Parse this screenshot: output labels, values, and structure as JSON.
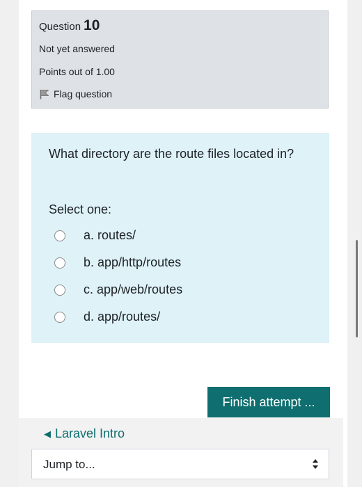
{
  "question": {
    "label": "Question",
    "number": "10",
    "state": "Not yet answered",
    "grade": "Points out of 1.00",
    "flag_label": "Flag question"
  },
  "formulation": {
    "text": "What directory are the route files located in?",
    "prompt": "Select one:",
    "options": [
      {
        "label": "a. routes/"
      },
      {
        "label": "b. app/http/routes"
      },
      {
        "label": "c. app/web/routes"
      },
      {
        "label": "d. app/routes/"
      }
    ]
  },
  "finish_button": {
    "label": "Finish attempt ..."
  },
  "nav": {
    "prev_label": "Laravel Intro",
    "jump_label": "Jump to..."
  },
  "colors": {
    "info_bg": "#dee2e6",
    "formulation_bg": "#def2f8",
    "accent": "#0f6e6f"
  },
  "icons": [
    "flag-icon",
    "triangle-left-icon",
    "select-arrows-icon"
  ]
}
